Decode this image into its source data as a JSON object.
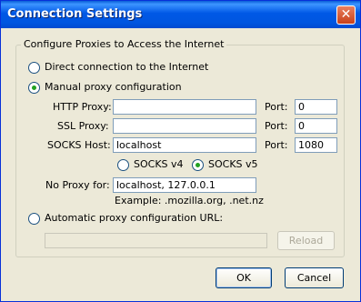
{
  "window": {
    "title": "Connection Settings",
    "close_glyph": "✕"
  },
  "group": {
    "legend": "Configure Proxies to Access the Internet"
  },
  "mode_options": {
    "direct": {
      "label": "Direct connection to the Internet",
      "checked": false
    },
    "manual": {
      "label": "Manual proxy configuration",
      "checked": true
    },
    "auto": {
      "label": "Automatic proxy configuration URL:",
      "checked": false
    }
  },
  "proxies": {
    "http": {
      "label": "HTTP Proxy:",
      "value": "",
      "port_label": "Port:",
      "port": "0"
    },
    "ssl": {
      "label": "SSL Proxy:",
      "value": "",
      "port_label": "Port:",
      "port": "0"
    },
    "socks": {
      "label": "SOCKS Host:",
      "value": "localhost",
      "port_label": "Port:",
      "port": "1080"
    }
  },
  "socks_version": {
    "v4": {
      "label": "SOCKS v4",
      "checked": false
    },
    "v5": {
      "label": "SOCKS v5",
      "checked": true
    }
  },
  "no_proxy": {
    "label": "No Proxy for:",
    "value": "localhost, 127.0.0.1",
    "example": "Example: .mozilla.org, .net.nz"
  },
  "auto_config": {
    "url": "",
    "reload_label": "Reload"
  },
  "buttons": {
    "ok": "OK",
    "cancel": "Cancel"
  }
}
